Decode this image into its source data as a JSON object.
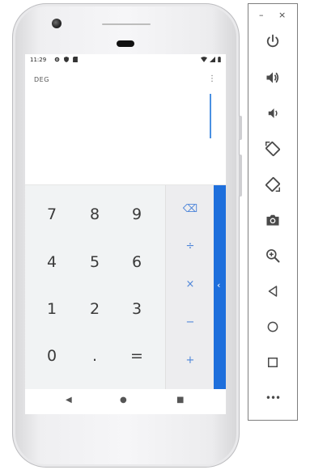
{
  "status_bar": {
    "time": "11:29"
  },
  "display": {
    "mode": "DEG",
    "overflow_menu": "⋮"
  },
  "keypad": {
    "keys": [
      "7",
      "8",
      "9",
      "4",
      "5",
      "6",
      "1",
      "2",
      "3",
      "0",
      ".",
      "="
    ]
  },
  "operators": {
    "items": [
      "⌫",
      "÷",
      "×",
      "−",
      "+"
    ]
  },
  "drawer": {
    "chevron": "‹"
  },
  "navbar": {
    "back": "◀",
    "home": "●",
    "recents": "■"
  },
  "emulator_panel": {
    "minimize": "–",
    "close": "×",
    "buttons": [
      "power",
      "volume-up",
      "volume-down",
      "rotate-left",
      "rotate-right",
      "screenshot",
      "zoom",
      "back",
      "home",
      "overview",
      "more"
    ],
    "more_label": "•••"
  },
  "colors": {
    "accent": "#1e6fdc",
    "operator_text": "#4f86d9",
    "keypad_bg": "#f1f3f4"
  }
}
